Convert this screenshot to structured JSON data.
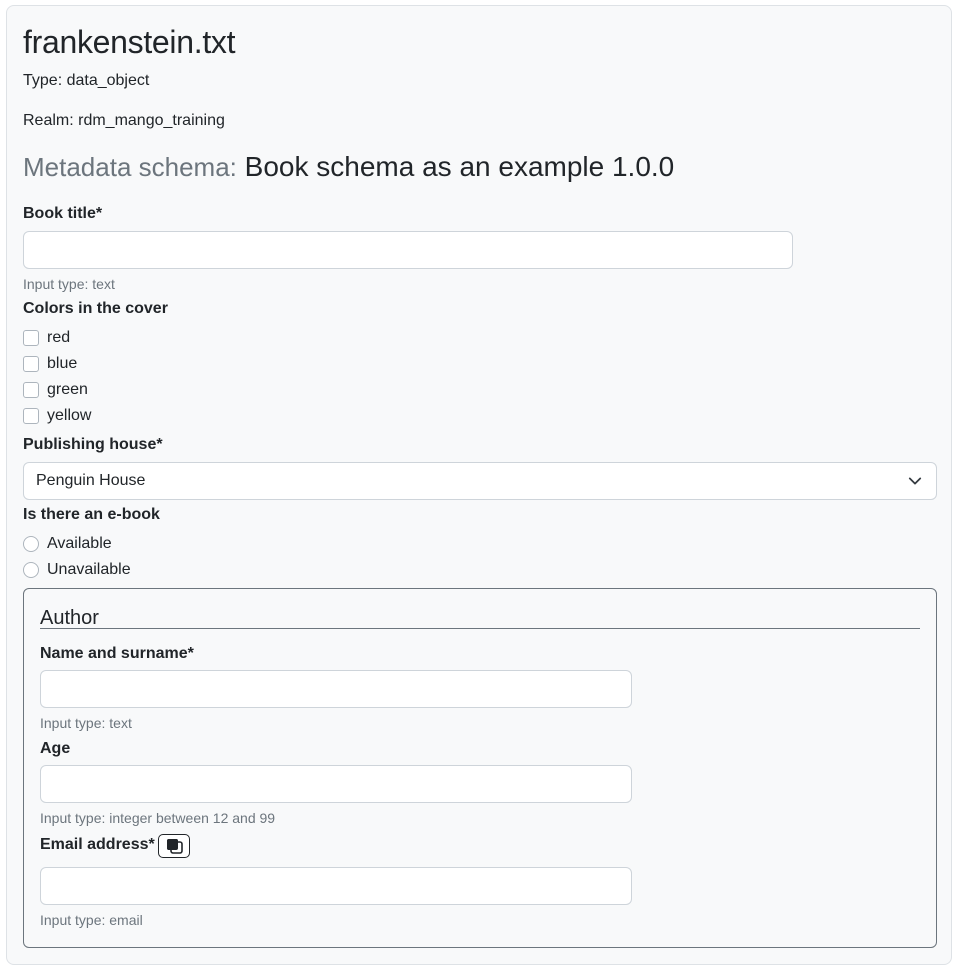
{
  "file": {
    "name": "frankenstein.txt",
    "type": "Type: data_object",
    "realm": "Realm: rdm_mango_training"
  },
  "schema": {
    "label": "Metadata schema:",
    "name": "Book schema as an example 1.0.0"
  },
  "fields": {
    "book_title": {
      "label": "Book title*",
      "value": "",
      "help": "Input type: text"
    },
    "colors": {
      "label": "Colors in the cover",
      "options": [
        "red",
        "blue",
        "green",
        "yellow"
      ]
    },
    "publishing_house": {
      "label": "Publishing house*",
      "selected": "Penguin House"
    },
    "ebook": {
      "label": "Is there an e-book",
      "options": [
        "Available",
        "Unavailable"
      ]
    }
  },
  "author": {
    "legend": "Author",
    "name": {
      "label": "Name and surname*",
      "value": "",
      "help": "Input type: text"
    },
    "age": {
      "label": "Age",
      "value": "",
      "help": "Input type: integer between 12 and 99"
    },
    "email": {
      "label": "Email address*",
      "value": "",
      "help": "Input type: email",
      "button_icon": "copy-icon"
    }
  },
  "colors": {
    "accent": "#212529",
    "muted": "#6c757d",
    "background": "#f8f9fa",
    "border": "#ced4da"
  }
}
